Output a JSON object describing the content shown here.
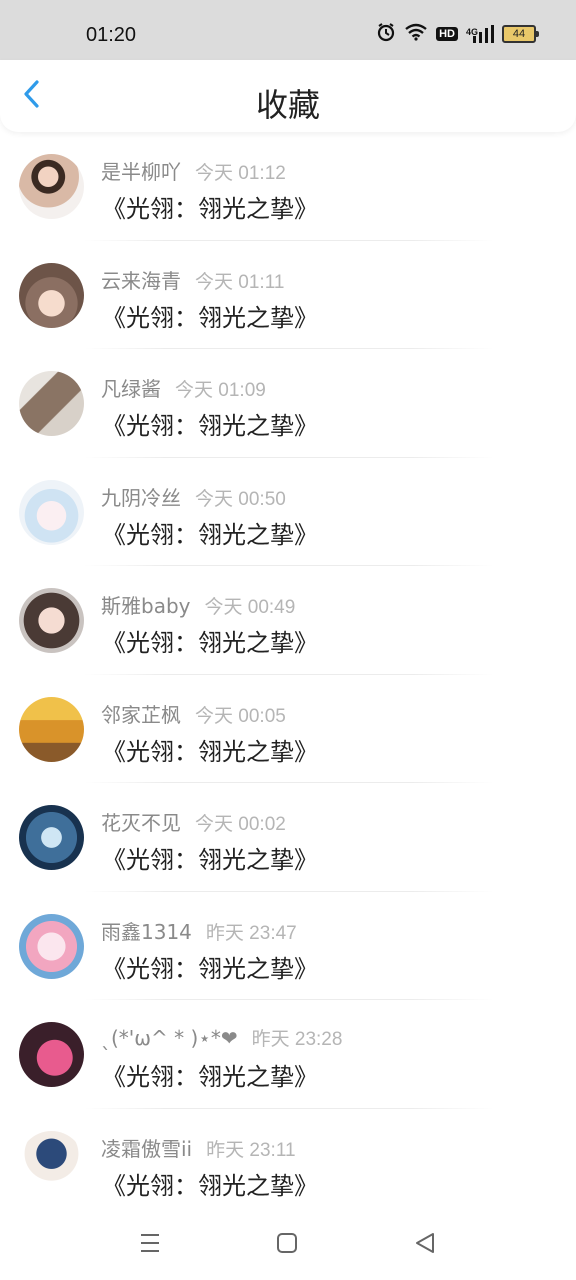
{
  "status_bar": {
    "time": "01:20",
    "hd_label": "HD",
    "network_label": "4G",
    "battery_level": "44",
    "icons": [
      "alarm-icon",
      "wifi-icon",
      "hd-icon",
      "signal-icon",
      "battery-icon"
    ]
  },
  "header": {
    "title": "收藏",
    "back_icon": "chevron-left-icon",
    "accent_color": "#2f9bea"
  },
  "favorites": [
    {
      "user": "是半柳吖",
      "time": "今天 01:12",
      "title": "《光翎：翎光之挚》"
    },
    {
      "user": "云来海青",
      "time": "今天 01:11",
      "title": "《光翎：翎光之挚》"
    },
    {
      "user": "凡绿酱",
      "time": "今天 01:09",
      "title": "《光翎：翎光之挚》"
    },
    {
      "user": "九阴冷丝",
      "time": "今天 00:50",
      "title": "《光翎：翎光之挚》"
    },
    {
      "user": "斯雅baby",
      "time": "今天 00:49",
      "title": "《光翎：翎光之挚》"
    },
    {
      "user": "邻家芷枫",
      "time": "今天 00:05",
      "title": "《光翎：翎光之挚》"
    },
    {
      "user": "花灭不见",
      "time": "今天 00:02",
      "title": "《光翎：翎光之挚》"
    },
    {
      "user": "雨鑫1314",
      "time": "昨天 23:47",
      "title": "《光翎：翎光之挚》"
    },
    {
      "user": "ˎ(*'ω^ * )⋆*❤",
      "time": "昨天 23:28",
      "title": "《光翎：翎光之挚》"
    },
    {
      "user": "凌霜傲雪ii",
      "time": "昨天 23:11",
      "title": "《光翎：翎光之挚》"
    }
  ],
  "nav_bar": {
    "icons": [
      "menu-icon",
      "home-icon",
      "back-icon"
    ]
  }
}
